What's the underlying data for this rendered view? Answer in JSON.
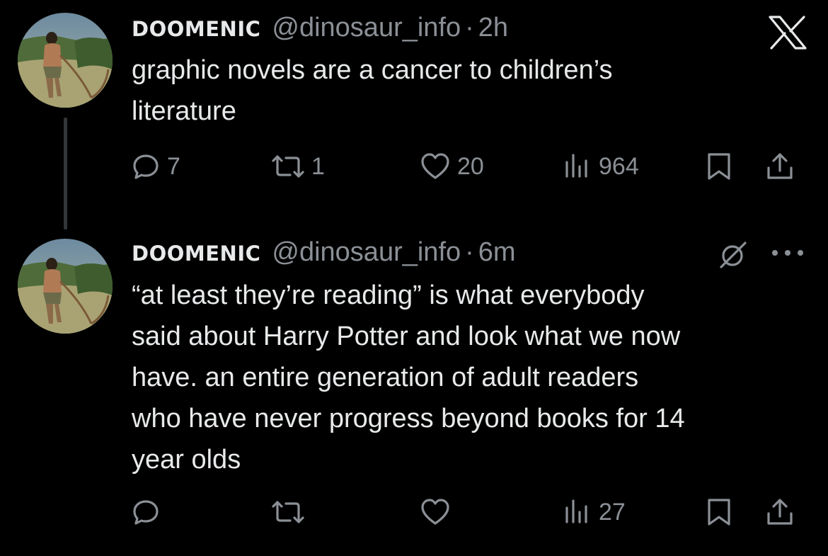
{
  "brand": {
    "logo_icon": "x-logo-icon",
    "background": "#000000",
    "text_color": "#e7e9ea",
    "muted_color": "#8b9096",
    "thread_line_color": "#333639"
  },
  "tweets": [
    {
      "display_name": "DOOMENIC",
      "handle": "@dinosaur_info",
      "separator": "·",
      "time": "2h",
      "text": "graphic novels are a cancer to children’s\nliterature",
      "replies": "7",
      "reposts": "1",
      "likes": "20",
      "views": "964"
    },
    {
      "display_name": "DOOMENIC",
      "handle": "@dinosaur_info",
      "separator": "·",
      "time": "6m",
      "text": "“at least they’re reading” is what everybody\nsaid about Harry Potter and look what we now\nhave. an entire generation of adult readers\nwho have never progress beyond books for 14\nyear olds",
      "replies": "",
      "reposts": "",
      "likes": "",
      "views": "27"
    }
  ],
  "icons": {
    "reply": "reply-icon",
    "repost": "repost-icon",
    "like": "heart-icon",
    "views": "views-icon",
    "bookmark": "bookmark-icon",
    "share": "share-icon",
    "grok": "grok-icon",
    "more": "more-icon"
  }
}
